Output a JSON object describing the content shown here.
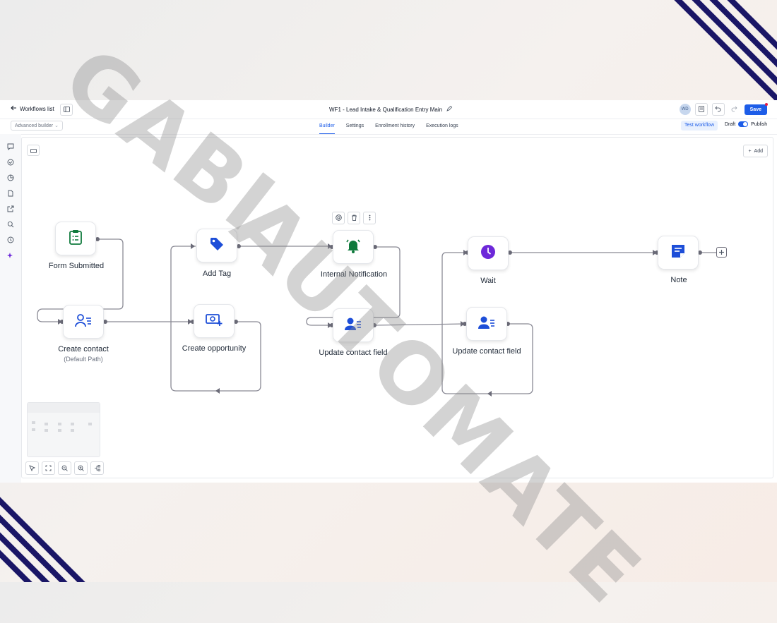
{
  "topbar": {
    "back_label": "Workflows list",
    "workflow_title": "WF1 - Lead Intake & Qualification Entry Main",
    "avatar_initials": "WD",
    "save_label": "Save"
  },
  "subbar": {
    "builder_mode": "Advanced builder",
    "tabs": [
      {
        "label": "Builder",
        "active": true
      },
      {
        "label": "Settings",
        "active": false
      },
      {
        "label": "Enrollment history",
        "active": false
      },
      {
        "label": "Execution logs",
        "active": false
      }
    ],
    "test_label": "Test workflow",
    "draft_label": "Draft",
    "publish_label": "Publish"
  },
  "canvas": {
    "add_label": "Add",
    "nodes": [
      {
        "label": "Form Submitted",
        "icon": "clipboard-icon",
        "color": "#0f7a3c"
      },
      {
        "label": "Create contact",
        "sub": "(Default Path)",
        "icon": "contact-list-icon",
        "color": "#1d4ed8"
      },
      {
        "label": "Add Tag",
        "icon": "tag-icon",
        "color": "#1d4ed8"
      },
      {
        "label": "Create opportunity",
        "icon": "money-plus-icon",
        "color": "#1d4ed8"
      },
      {
        "label": "Internal Notification",
        "icon": "bell-icon",
        "color": "#0f7a3c"
      },
      {
        "label": "Update contact field",
        "icon": "person-lines-icon",
        "color": "#1d4ed8"
      },
      {
        "label": "Wait",
        "icon": "clock-icon",
        "color": "#6d28d9"
      },
      {
        "label": "Update contact field",
        "icon": "person-lines-icon",
        "color": "#1d4ed8"
      },
      {
        "label": "Note",
        "icon": "note-icon",
        "color": "#1d4ed8"
      }
    ]
  },
  "watermark": [
    "GABI",
    "AUTOMATE"
  ]
}
